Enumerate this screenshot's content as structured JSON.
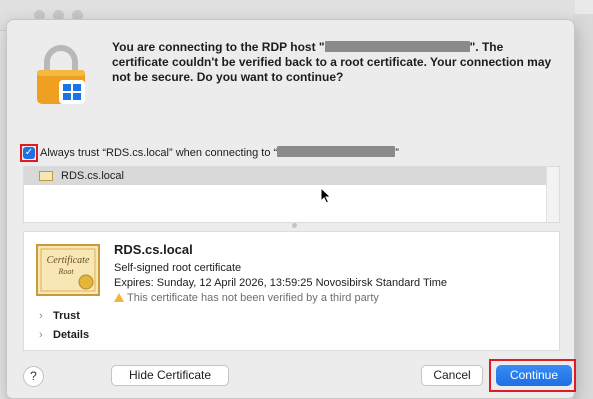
{
  "dialog": {
    "message_before_host": "You are connecting to the RDP host \"",
    "message_after_host": "\". The certificate couldn't be verified back to a root certificate. Your connection may not be secure. Do you want to continue?",
    "trust_checkbox_checked": true,
    "trust_label_before": "Always trust “RDS.cs.local” when connecting to “",
    "trust_label_after": "”"
  },
  "cert_list": {
    "items": [
      {
        "label": "RDS.cs.local",
        "icon": "certificate-icon",
        "selected": true
      }
    ]
  },
  "certificate": {
    "image_text_line1": "Certificate",
    "image_text_line2": "Root",
    "name": "RDS.cs.local",
    "type": "Self-signed root certificate",
    "expires": "Expires: Sunday, 12 April 2026, 13:59:25 Novosibirsk Standard Time",
    "warning": "This certificate has not been verified by a third party",
    "sections": [
      "Trust",
      "Details"
    ]
  },
  "buttons": {
    "help": "?",
    "hide_certificate": "Hide Certificate",
    "cancel": "Cancel",
    "continue": "Continue"
  },
  "colors": {
    "accent": "#1f6fe5",
    "highlight": "#e01b24",
    "lock_body": "#f0a020",
    "windows_blue": "#1a73e8"
  }
}
